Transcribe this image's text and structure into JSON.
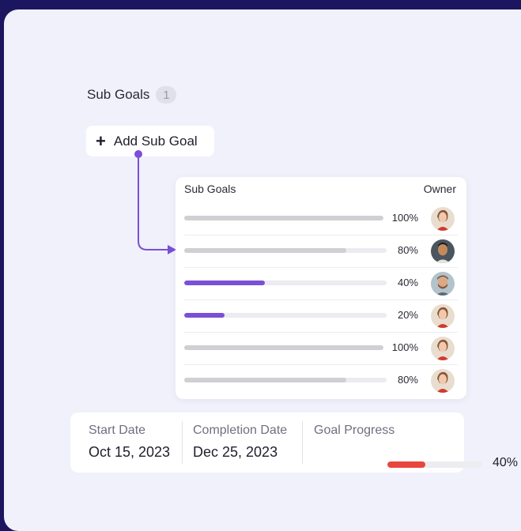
{
  "sub_goals": {
    "title": "Sub Goals",
    "count": "1",
    "add_button_label": "Add Sub Goal"
  },
  "table": {
    "header_left": "Sub Goals",
    "header_right": "Owner",
    "rows": [
      {
        "progress": 1.0,
        "label": "100%",
        "color": "#cfcfd4",
        "avatar": "avatar-woman"
      },
      {
        "progress": 0.8,
        "label": "80%",
        "color": "#cfcfd4",
        "avatar": "avatar-man"
      },
      {
        "progress": 0.4,
        "label": "40%",
        "color": "#7b4fd6",
        "avatar": "avatar-bearded-man"
      },
      {
        "progress": 0.2,
        "label": "20%",
        "color": "#7b4fd6",
        "avatar": "avatar-woman"
      },
      {
        "progress": 1.0,
        "label": "100%",
        "color": "#cfcfd4",
        "avatar": "avatar-woman"
      },
      {
        "progress": 0.8,
        "label": "80%",
        "color": "#cfcfd4",
        "avatar": "avatar-woman"
      }
    ]
  },
  "dates": {
    "start_label": "Start Date",
    "start_value": "Oct 15, 2023",
    "completion_label": "Completion Date",
    "completion_value": "Dec 25, 2023",
    "progress_label": "Goal Progress"
  },
  "goal_progress": {
    "value": 0.4,
    "label": "40%",
    "color": "#e8463e"
  },
  "colors": {
    "accent": "#7b4fd6",
    "background": "#1c1660",
    "panel": "#f0f1fb"
  }
}
